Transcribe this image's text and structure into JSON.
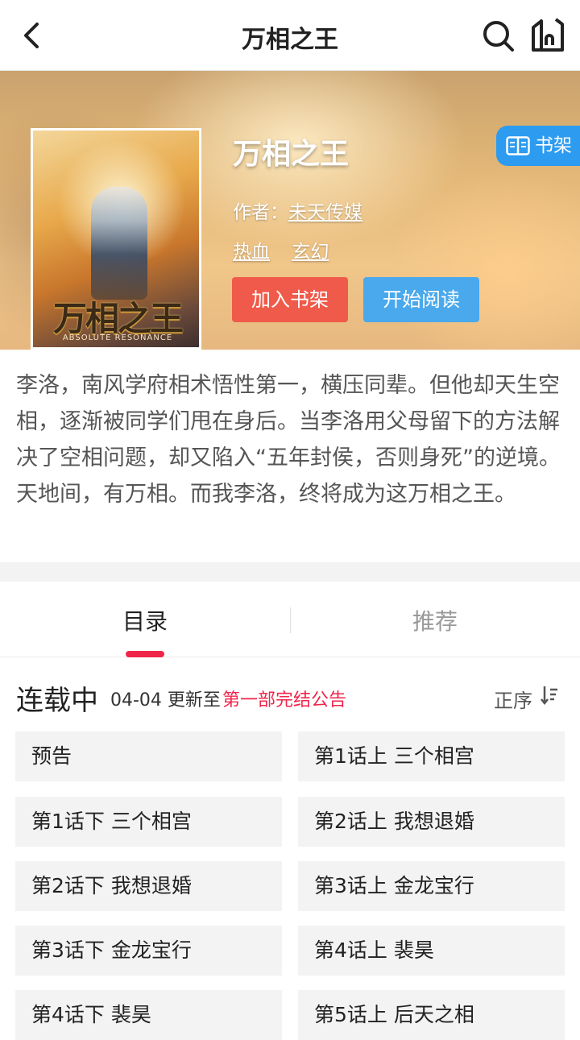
{
  "nav": {
    "title": "万相之王",
    "back_icon": "chevron-left-icon",
    "search_icon": "search-icon",
    "shelf_icon": "bookshelf-icon"
  },
  "book": {
    "title": "万相之王",
    "author_label": "作者：",
    "author": "未天传媒",
    "genres": [
      "热血",
      "玄幻"
    ],
    "cover_title": "万相之王",
    "cover_subtitle": "ABSOLUTE RESONANCE",
    "add_to_shelf_label": "加入书架",
    "start_reading_label": "开始阅读",
    "shelf_tab_label": "书架"
  },
  "description": "李洛，南风学府相术悟性第一，横压同辈。但他却天生空相，逐渐被同学们甩在身后。当李洛用父母留下的方法解决了空相问题，却又陷入“五年封侯，否则身死”的逆境。天地间，有万相。而我李洛，终将成为这万相之王。",
  "tabs": [
    {
      "label": "目录",
      "active": true
    },
    {
      "label": "推荐",
      "active": false
    }
  ],
  "status": {
    "label": "连载中",
    "date": "04-04 更新至",
    "latest": "第一部完结公告",
    "sort_label": "正序"
  },
  "chapters": [
    "预告",
    "第1话上 三个相宫",
    "第1话下 三个相宫",
    "第2话上 我想退婚",
    "第2话下 我想退婚",
    "第3话上 金龙宝行",
    "第3话下 金龙宝行",
    "第4话上 裴昊",
    "第4话下 裴昊",
    "第5话上 后天之相"
  ],
  "colors": {
    "accent": "#f0254a",
    "add_button": "#f05a4a",
    "read_button": "#4aa9ec",
    "shelf_tab": "#2c9bf0"
  }
}
